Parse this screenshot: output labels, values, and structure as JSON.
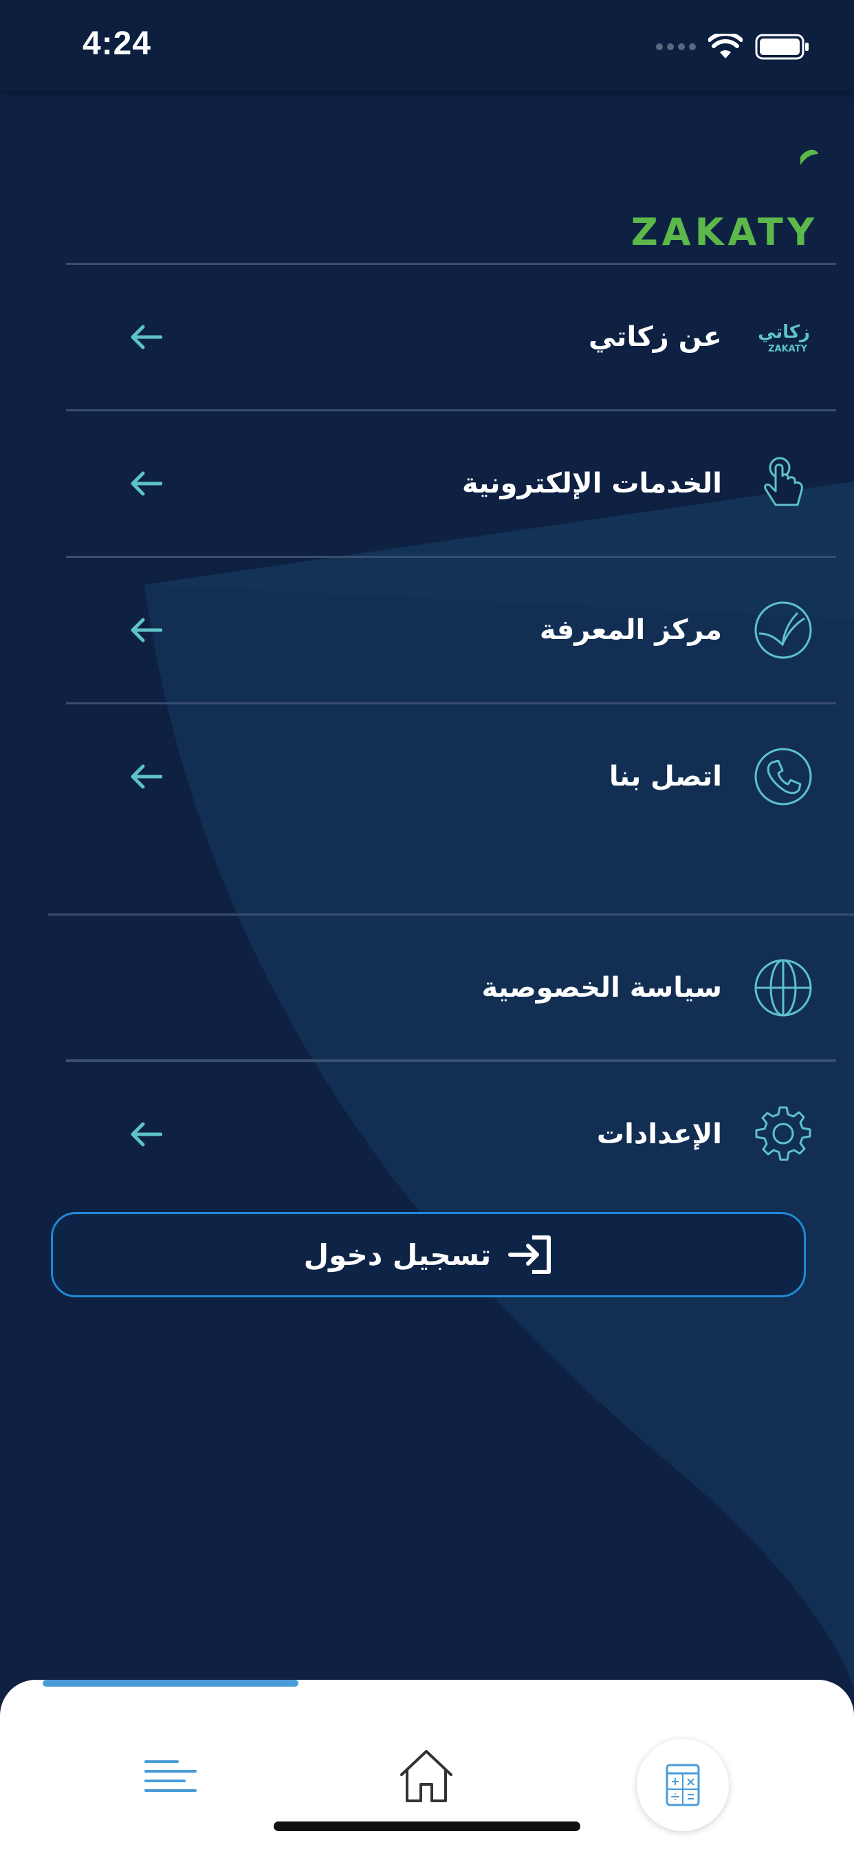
{
  "status_bar": {
    "time": "4:24"
  },
  "brand": {
    "logo_text_ar": "زكاتي",
    "logo_text_en": "ZAKATY",
    "green": "#5cb84a"
  },
  "colors": {
    "accent": "#5ec2c9",
    "background": "#0e2143",
    "button_border": "#1f8ad6",
    "nav_blue": "#4a9cd9"
  },
  "menu": {
    "items": [
      {
        "label": "عن زكاتي",
        "icon": "zakaty-logo-icon"
      },
      {
        "label": "الخدمات الإلكترونية",
        "icon": "touch-hand-icon"
      },
      {
        "label": "مركز المعرفة",
        "icon": "book-icon"
      },
      {
        "label": "اتصل بنا",
        "icon": "phone-icon"
      }
    ],
    "secondary": [
      {
        "label": "سياسة الخصوصية",
        "icon": "globe-icon"
      },
      {
        "label": "الإعدادات",
        "icon": "gear-icon"
      }
    ]
  },
  "login": {
    "label": "تسجيل دخول"
  },
  "bottom_nav": {
    "items": [
      "menu-icon",
      "home-icon",
      "calculator-icon"
    ]
  }
}
